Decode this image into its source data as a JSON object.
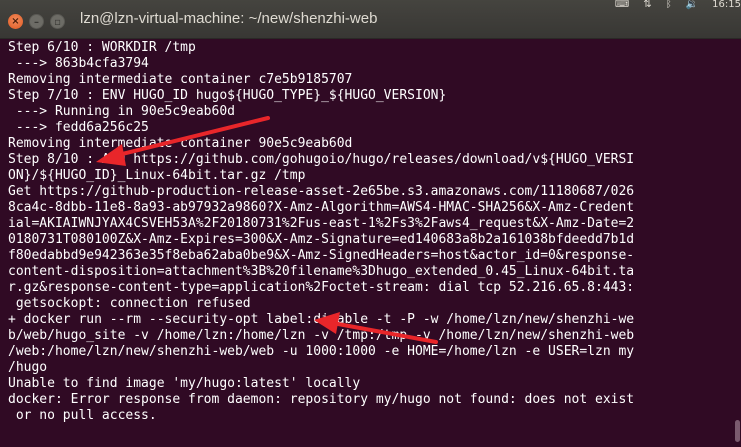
{
  "window": {
    "title": "lzn@lzn-virtual-machine: ~/new/shenzhi-web",
    "close_glyph": "×",
    "minimize_glyph": "–",
    "maximize_glyph": "▫"
  },
  "tray": {
    "keyboard": "⌨",
    "input_method": "⇅",
    "bluetooth": "ᛒ",
    "volume": "🔉",
    "clock": "16:15"
  },
  "terminal": {
    "lines": [
      "Step 6/10 : WORKDIR /tmp",
      " ---> 863b4cfa3794",
      "Removing intermediate container c7e5b9185707",
      "Step 7/10 : ENV HUGO_ID hugo${HUGO_TYPE}_${HUGO_VERSION}",
      " ---> Running in 90e5c9eab60d",
      " ---> fedd6a256c25",
      "Removing intermediate container 90e5c9eab60d",
      "Step 8/10 : ADD https://github.com/gohugoio/hugo/releases/download/v${HUGO_VERSI",
      "ON}/${HUGO_ID}_Linux-64bit.tar.gz /tmp",
      "Get https://github-production-release-asset-2e65be.s3.amazonaws.com/11180687/026",
      "8ca4c-8dbb-11e8-8a93-ab97932a9860?X-Amz-Algorithm=AWS4-HMAC-SHA256&X-Amz-Credent",
      "ial=AKIAIWNJYAX4CSVEH53A%2F20180731%2Fus-east-1%2Fs3%2Faws4_request&X-Amz-Date=2",
      "0180731T080100Z&X-Amz-Expires=300&X-Amz-Signature=ed140683a8b2a161038bfdeedd7b1d",
      "f80edabbd9e942363e35f8eba62aba0be9&X-Amz-SignedHeaders=host&actor_id=0&response-",
      "content-disposition=attachment%3B%20filename%3Dhugo_extended_0.45_Linux-64bit.ta",
      "r.gz&response-content-type=application%2Foctet-stream: dial tcp 52.216.65.8:443:",
      " getsockopt: connection refused",
      "+ docker run --rm --security-opt label:disable -t -P -w /home/lzn/new/shenzhi-we",
      "b/web/hugo_site -v /home/lzn:/home/lzn -v /tmp:/tmp -v /home/lzn/new/shenzhi-web",
      "/web:/home/lzn/new/shenzhi-web/web -u 1000:1000 -e HOME=/home/lzn -e USER=lzn my",
      "/hugo",
      "Unable to find image 'my/hugo:latest' locally",
      "docker: Error response from daemon: repository my/hugo not found: does not exist",
      " or no pull access."
    ]
  },
  "colors": {
    "terminal_bg": "#300a24",
    "text": "#ffffff",
    "arrow": "#e8262a",
    "titlebar": "#3c3b37"
  }
}
